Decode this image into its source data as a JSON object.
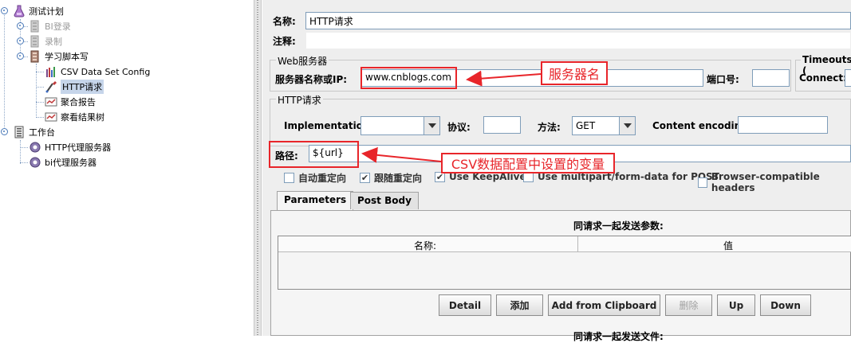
{
  "tree": {
    "items": [
      {
        "label": "测试计划"
      },
      {
        "label": "BI登录"
      },
      {
        "label": "录制"
      },
      {
        "label": "学习脚本写"
      },
      {
        "label": "CSV Data Set Config"
      },
      {
        "label": "HTTP请求"
      },
      {
        "label": "聚合报告"
      },
      {
        "label": "察看结果树"
      },
      {
        "label": "工作台"
      },
      {
        "label": "HTTP代理服务器"
      },
      {
        "label": "bi代理服务器"
      }
    ]
  },
  "form": {
    "name_label": "名称:",
    "name_value": "HTTP请求",
    "comment_label": "注释:",
    "web_server_legend": "Web服务器",
    "server_label": "服务器名称或IP:",
    "server_value": "www.cnblogs.com",
    "port_label": "端口号:",
    "timeouts_legend": "Timeouts (",
    "connect_label": "Connect:",
    "http_request_legend": "HTTP请求",
    "implementation_label": "Implementation:",
    "protocol_label": "协议:",
    "method_label": "方法:",
    "method_value": "GET",
    "encoding_label": "Content encoding:",
    "path_label": "路径:",
    "path_value": "${url}"
  },
  "checkboxes": [
    {
      "label": "自动重定向",
      "checked": false
    },
    {
      "label": "跟随重定向",
      "checked": true
    },
    {
      "label": "Use KeepAlive",
      "checked": true
    },
    {
      "label": "Use multipart/form-data for POST",
      "checked": false
    },
    {
      "label": "Browser-compatible headers",
      "checked": false
    }
  ],
  "tabs": {
    "parameters": "Parameters",
    "post_body": "Post Body"
  },
  "params_table": {
    "title": "同请求一起发送参数:",
    "col_name": "名称:",
    "col_value": "值"
  },
  "buttons": {
    "detail": "Detail",
    "add": "添加",
    "add_from_clipboard": "Add from Clipboard",
    "delete": "删除",
    "up": "Up",
    "down": "Down"
  },
  "files_title": "同请求一起发送文件:",
  "annotations": {
    "server_note": "服务器名",
    "path_note": "CSV数据配置中设置的变量"
  },
  "colors": {
    "annotation": "#e8252a",
    "selection": "#c6d5ea",
    "panel_bg": "#eeeeee"
  }
}
